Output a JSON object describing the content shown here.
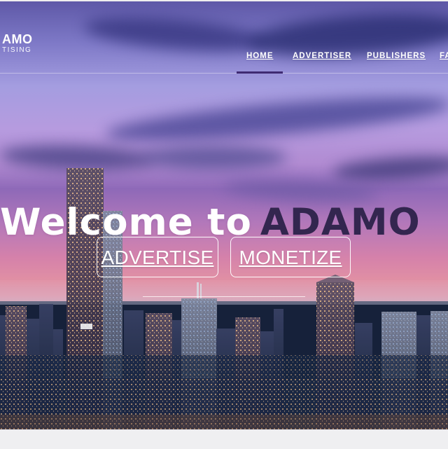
{
  "logo": {
    "main": "AMO",
    "sub": "TISING"
  },
  "navigation": {
    "items": [
      {
        "label": "HOME"
      },
      {
        "label": "ADVERTISER"
      },
      {
        "label": "PUBLISHERS"
      },
      {
        "label": "FA"
      }
    ]
  },
  "hero": {
    "title_prefix": "Welcome to",
    "title_brand": "ADAMO",
    "buttons": [
      {
        "label": "ADVERTISE"
      },
      {
        "label": "MONETIZE"
      }
    ]
  },
  "colors": {
    "nav_active": "#3f2a72",
    "brand_text": "#33264f",
    "button_border": "#ffffff"
  }
}
